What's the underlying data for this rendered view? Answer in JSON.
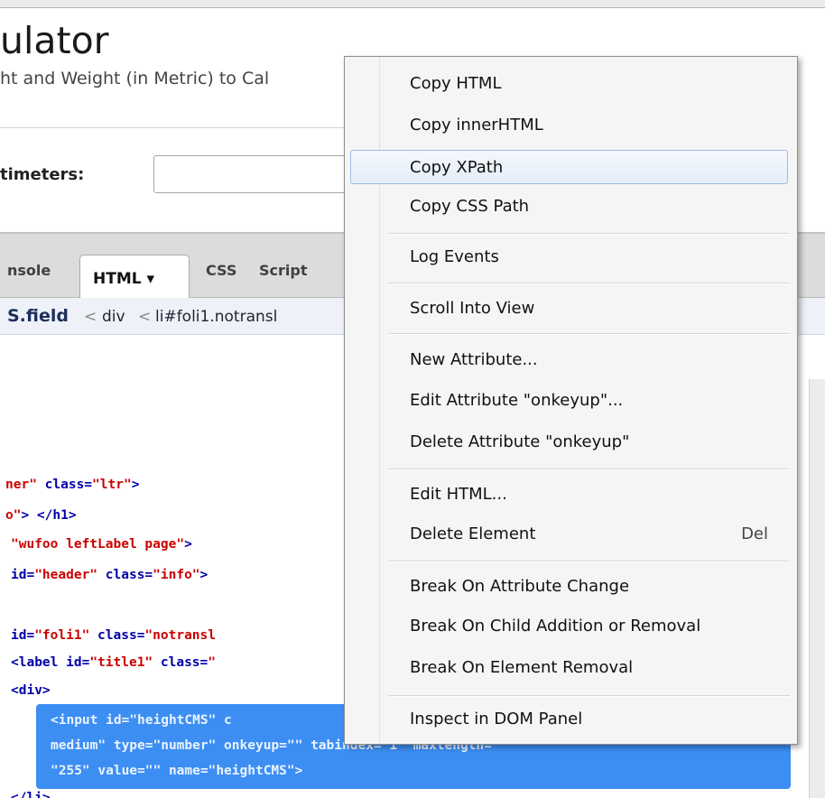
{
  "page": {
    "title": "ulator",
    "description": "ht and Weight (in Metric) to Cal",
    "field_label": "timeters:"
  },
  "firebug": {
    "tabs": {
      "console": "nsole",
      "html": "HTML ▾",
      "css": "CSS",
      "script": "Script"
    },
    "breadcrumb": {
      "current": "S.field",
      "sep": "<",
      "item1": "div",
      "item2": "li#foli1.notransl"
    },
    "code": {
      "l1a": "ner\"",
      "l1b": " class=",
      "l1c": "\"ltr\"",
      "l1d": ">",
      "l2a": "o\"",
      "l2b": ">  </h1>",
      "l3a": "\"wufoo leftLabel page\"",
      "l3b": ">",
      "l4a": " id=",
      "l4b": "\"header\"",
      "l4c": " class=",
      "l4d": "\"info\"",
      "l4e": ">",
      "l5a": "id=",
      "l5b": "\"foli1\"",
      "l5c": " class=",
      "l5d": "\"notransl",
      "l6a": "<label id=",
      "l6b": "\"title1\"",
      "l6c": " class=",
      "l6d": "\"",
      "l7": "<div>",
      "s1": "<input id=\"heightCMS\" c",
      "s2": "medium\" type=\"number\" onkeyup=\"\" tabindex=\"1\" maxlength=",
      "s3": "\"255\" value=\"\" name=\"heightCMS\">",
      "l8": "</li>"
    }
  },
  "context_menu": {
    "items": [
      {
        "label": "Copy HTML"
      },
      {
        "label": "Copy innerHTML"
      },
      {
        "label": "Copy XPath"
      },
      {
        "label": "Copy CSS Path"
      },
      {
        "label": "Log Events"
      },
      {
        "label": "Scroll Into View"
      },
      {
        "label": "New Attribute..."
      },
      {
        "label": "Edit Attribute \"onkeyup\"..."
      },
      {
        "label": "Delete Attribute \"onkeyup\""
      },
      {
        "label": "Edit HTML..."
      },
      {
        "label": "Delete Element",
        "shortcut": "Del"
      },
      {
        "label": "Break On Attribute Change"
      },
      {
        "label": "Break On Child Addition or Removal"
      },
      {
        "label": "Break On Element Removal"
      },
      {
        "label": "Inspect in DOM Panel"
      }
    ]
  },
  "colors": {
    "selection": "#3c8ef3",
    "menu_highlight_border": "#9cbde9",
    "code_tag": "#0000aa",
    "code_value": "#cc0000"
  }
}
